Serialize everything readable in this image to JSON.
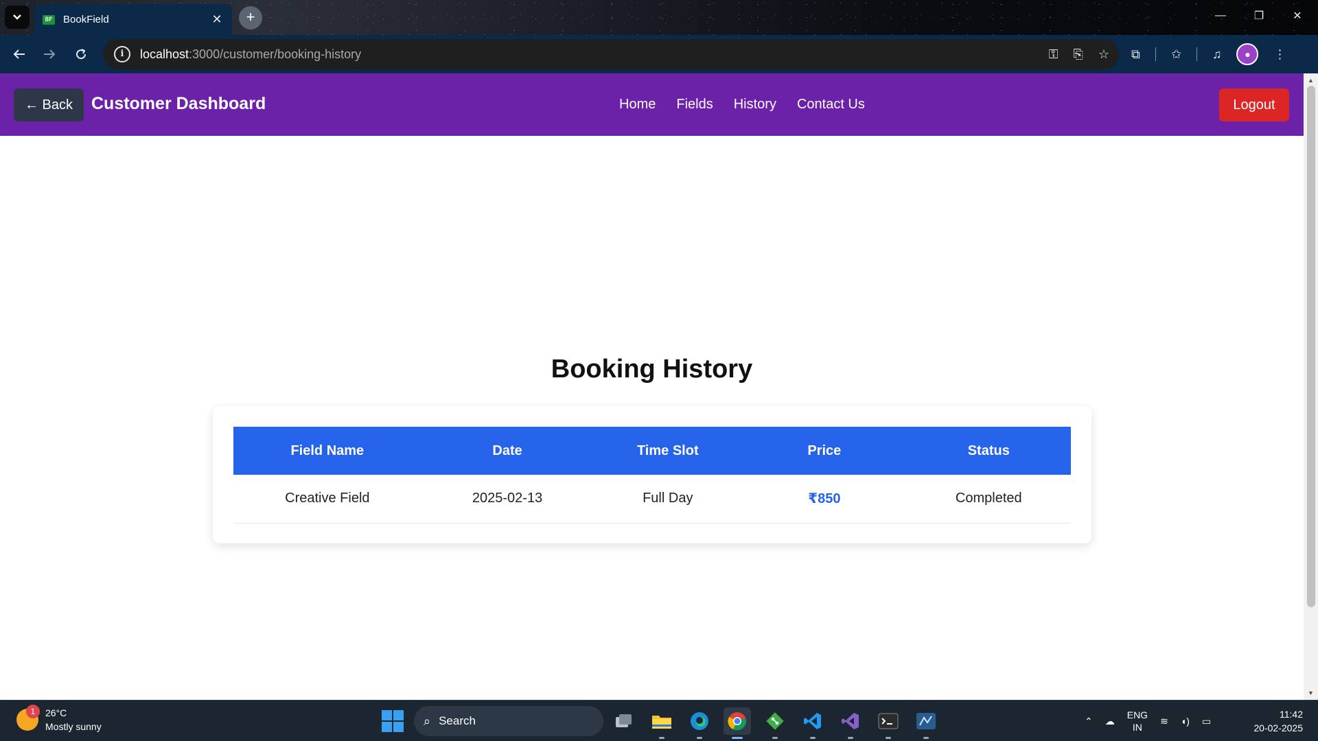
{
  "browser": {
    "tab_title": "BookField",
    "tab_favicon_text": "BF",
    "url_host": "localhost",
    "url_path": ":3000/customer/booking-history"
  },
  "app": {
    "back_label": "← Back",
    "title": "Customer Dashboard",
    "nav": [
      {
        "label": "Home"
      },
      {
        "label": "Fields"
      },
      {
        "label": "History"
      },
      {
        "label": "Contact Us"
      }
    ],
    "logout_label": "Logout"
  },
  "booking": {
    "heading": "Booking History",
    "columns": [
      "Field Name",
      "Date",
      "Time Slot",
      "Price",
      "Status"
    ],
    "rows": [
      {
        "field": "Creative Field",
        "date": "2025-02-13",
        "slot": "Full Day",
        "price": "₹850",
        "status": "Completed"
      }
    ]
  },
  "colors": {
    "nav_bg": "#6b21a8",
    "header_bg": "#2563eb",
    "logout_bg": "#dc2626",
    "back_bg": "#2d3748"
  },
  "taskbar": {
    "weather_temp": "26°C",
    "weather_desc": "Mostly sunny",
    "weather_badge": "1",
    "search_label": "Search",
    "lang_top": "ENG",
    "lang_bottom": "IN",
    "time": "11:42",
    "date": "20-02-2025"
  },
  "icons": {
    "tab_list": "chevron-down-icon",
    "back": "arrow-left-icon",
    "forward": "arrow-right-icon",
    "reload": "reload-icon",
    "site_info": "info-icon",
    "password": "key-icon",
    "install": "install-icon",
    "bookmark": "star-icon",
    "extensions": "puzzle-icon",
    "favorites": "star-list-icon",
    "media": "media-icon",
    "menu": "kebab-icon"
  }
}
